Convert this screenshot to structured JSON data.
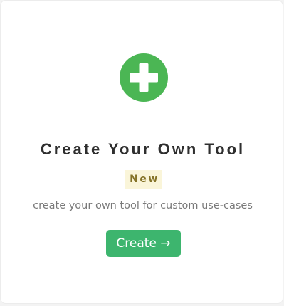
{
  "card": {
    "icon": "plus-circle-icon",
    "title": "Create Your Own Tool",
    "badge": "New",
    "description": "create your own tool for custom use-cases",
    "button_label": "Create →"
  },
  "colors": {
    "icon_green": "#4bb654",
    "button_green": "#3db56e",
    "badge_bg": "#faf5d9",
    "badge_text": "#857328",
    "title_text": "#2f2f2f",
    "description_text": "#7a7a7a"
  }
}
